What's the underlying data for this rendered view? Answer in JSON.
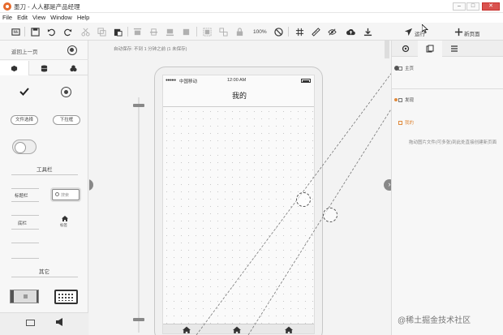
{
  "window": {
    "title": "墨刀 - 人人都是产品经理",
    "controls": {
      "min": "–",
      "max": "□",
      "close": "✕"
    }
  },
  "menu": [
    "File",
    "Edit",
    "View",
    "Window",
    "Help"
  ],
  "toolbar": {
    "zoom": "100%",
    "run_label": "运行",
    "new_page_label": "新页面"
  },
  "left_panel": {
    "back_label": "返回上一页",
    "file_select_label": "文件选择",
    "dropdown_label": "下拉框",
    "toolbar_section": "工具栏",
    "title_bar_label": "标题栏",
    "search_placeholder": "搜索",
    "bottom_bar_label": "底栏",
    "tab_label": "标签",
    "other_section": "其它"
  },
  "canvas": {
    "autosave": "自动保存: 不到 1 分钟之前 (1 未保存)",
    "phone": {
      "carrier": "中国移动",
      "signal": "●●●●●",
      "time": "12:00 AM",
      "title": "我的"
    }
  },
  "right_panel": {
    "pages": [
      {
        "name": "主页",
        "highlight": false
      },
      {
        "name": "发现",
        "highlight": false
      },
      {
        "name": "我的",
        "highlight": true
      }
    ],
    "hint": "拖动图片文件(可多张)到此处直接创建新页面"
  },
  "watermark": "@稀土掘金技术社区",
  "colors": {
    "accent": "#e08a3c",
    "logo": "#e66a2c",
    "close": "#d9534f"
  }
}
